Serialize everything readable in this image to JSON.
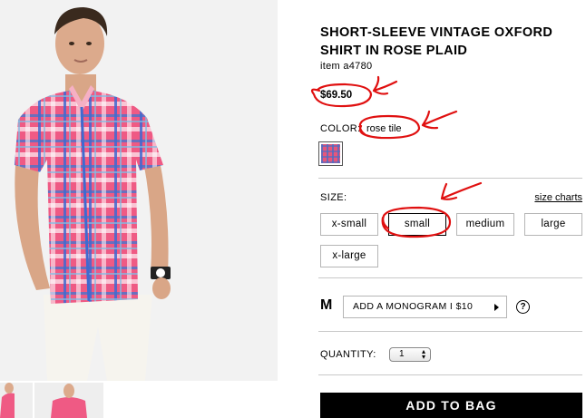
{
  "product": {
    "title": "SHORT-SLEEVE VINTAGE OXFORD SHIRT IN ROSE PLAID",
    "item_number": "item a4780",
    "price": "$69.50"
  },
  "color": {
    "label": "COLOR:",
    "value": "rose tile",
    "swatch_color": "#e8567a"
  },
  "size": {
    "label": "SIZE:",
    "chart_link": "size charts",
    "options": [
      "x-small",
      "small",
      "medium",
      "large",
      "x-large"
    ],
    "selected": "small"
  },
  "monogram": {
    "letter": "M",
    "button_label": "ADD A MONOGRAM I $10",
    "help_glyph": "?"
  },
  "quantity": {
    "label": "QUANTITY:",
    "value": "1"
  },
  "add_to_bag_label": "ADD TO BAG",
  "colors": {
    "shirt_pink": "#e8567a",
    "annotation_red": "#e01010"
  }
}
